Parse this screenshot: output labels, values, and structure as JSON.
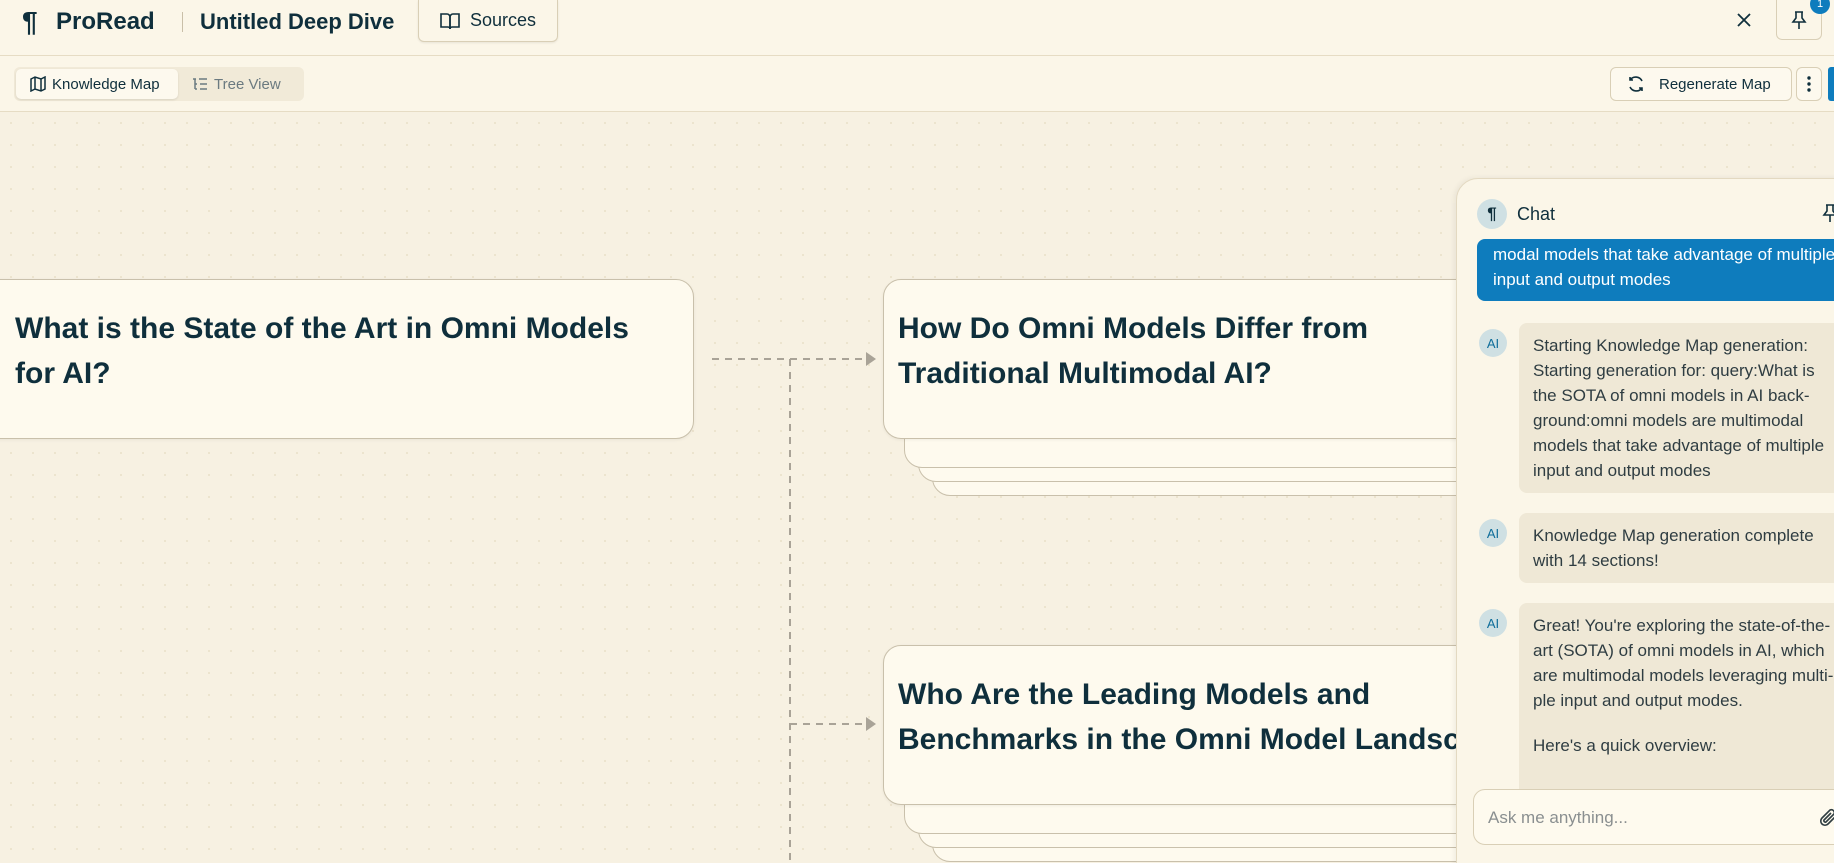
{
  "app": {
    "logo_glyph": "¶",
    "name": "ProRead",
    "document_title": "Untitled Deep Dive",
    "sources_label": "Sources",
    "notification_count": "1"
  },
  "toolbar": {
    "tabs": [
      {
        "label": "Knowledge Map",
        "icon": "map-icon",
        "active": true
      },
      {
        "label": "Tree View",
        "icon": "tree-list-icon",
        "active": false
      }
    ],
    "regenerate_label": "Regenerate Map"
  },
  "map": {
    "nodes": [
      {
        "title": "What is the State of the Art in Omni Models for AI?"
      },
      {
        "title": "How Do Omni Models Differ from Traditional Multimodal AI?"
      },
      {
        "title": "Who Are the Leading Models and Benchmarks in the Omni Model Landscape?"
      }
    ]
  },
  "chat": {
    "title": "Chat",
    "avatar_label": "AI",
    "user_message_visible": "modal models that take advantage of multiple input and output modes",
    "messages": [
      {
        "role": "ai",
        "lines": [
          "Starting Knowledge Map generation:",
          "Starting generation for: query:What is",
          "the SOTA of omni models in AI back-",
          "ground:omni models are multimodal",
          "models that take advantage of multiple",
          "input and output modes"
        ]
      },
      {
        "role": "ai",
        "lines": [
          "Knowledge Map generation complete",
          "with 14 sections!"
        ]
      },
      {
        "role": "ai",
        "lines": [
          "Great! You're exploring the state-of-the-",
          "art (SOTA) of omni models in AI, which",
          "are multimodal models leveraging multi-",
          "ple input and output modes."
        ],
        "followup": "Here's a quick overview:"
      }
    ],
    "input_placeholder": "Ask me anything..."
  },
  "colors": {
    "accent": "#0e7cbd",
    "background": "#f7f1e2",
    "text": "#0f2f3c"
  }
}
